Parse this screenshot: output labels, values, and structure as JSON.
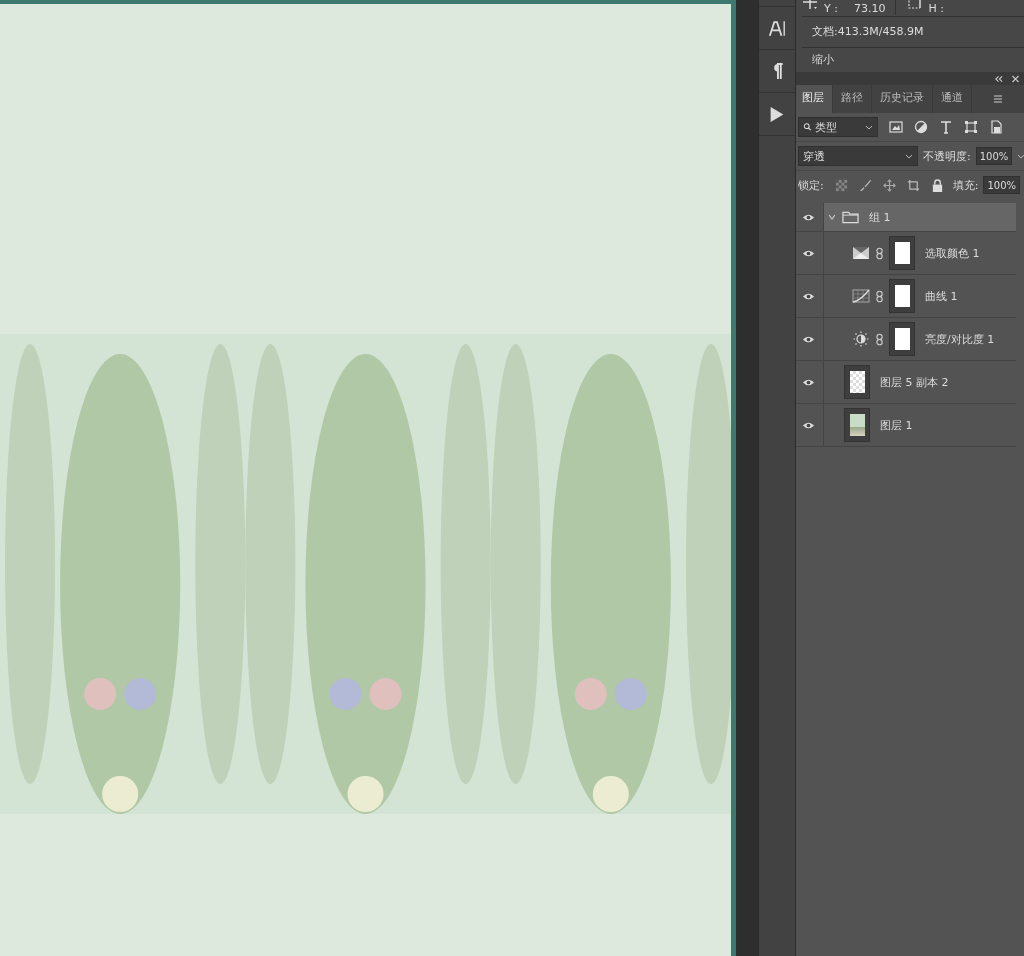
{
  "info_panel": {
    "y_label": "Y :",
    "y_value": "73.10",
    "h_label": "H :",
    "document": "文档:413.3M/458.9M",
    "zoom": "缩小"
  },
  "layers_panel": {
    "tabs": [
      {
        "label": "图层",
        "selected": true
      },
      {
        "label": "路径",
        "selected": false
      },
      {
        "label": "历史记录",
        "selected": false
      },
      {
        "label": "通道",
        "selected": false
      }
    ],
    "filter": {
      "value": "类型"
    },
    "blend_mode": "穿透",
    "opacity_label": "不透明度:",
    "opacity": "100%",
    "lock_label": "锁定:",
    "fill_label": "填充:",
    "fill": "100%",
    "layers": [
      {
        "name": "组 1",
        "kind": "group",
        "visible": true,
        "expanded": true,
        "selected": true,
        "children": [
          {
            "name": "选取颜色 1",
            "kind": "selectivecolor",
            "visible": true,
            "selected": false
          },
          {
            "name": "曲线 1",
            "kind": "curves",
            "visible": true,
            "selected": false
          },
          {
            "name": "亮度/对比度 1",
            "kind": "brightnesscontrast",
            "visible": true,
            "selected": false
          }
        ]
      },
      {
        "name": "图层 5 副本 2",
        "kind": "transparent",
        "visible": true,
        "selected": false
      },
      {
        "name": "图层 1",
        "kind": "image",
        "visible": true,
        "selected": false
      }
    ]
  }
}
